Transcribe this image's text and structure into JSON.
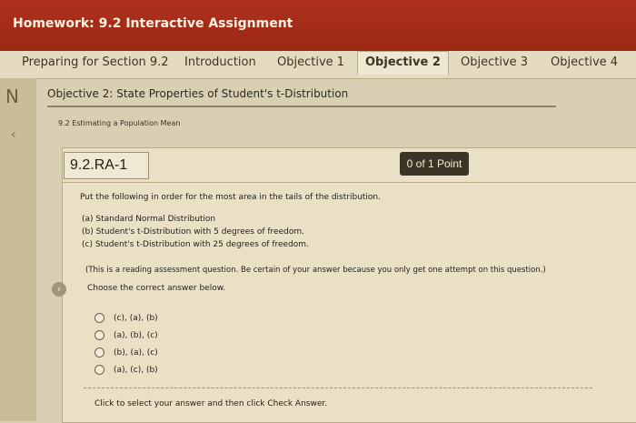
{
  "window": {
    "title": "Homework: 9.2 Interactive Assignment"
  },
  "tabs": [
    {
      "label": "Preparing for Section 9.2",
      "active": false
    },
    {
      "label": "Introduction",
      "active": false
    },
    {
      "label": "Objective 1",
      "active": false
    },
    {
      "label": "Objective 2",
      "active": true
    },
    {
      "label": "Objective 3",
      "active": false
    },
    {
      "label": "Objective 4",
      "active": false
    }
  ],
  "objective_heading": "Objective 2: State Properties of Student's t-Distribution",
  "section_label": "9.2 Estimating a Population Mean",
  "question": {
    "number": "9.2.RA-1",
    "points": "0 of 1 Point",
    "prompt": "Put the following in order for the most area in the tails of the distribution.",
    "items": [
      "(a) Standard Normal Distribution",
      "(b) Student's t-Distribution with 5 degrees of freedom.",
      "(c) Student's t-Distribution with 25 degrees of freedom."
    ],
    "note": "(This is a reading assessment question. Be certain of your answer because you only get one attempt on this question.)",
    "instruction": "Choose the correct answer below.",
    "options": [
      "(c), (a), (b)",
      "(a), (b), (c)",
      "(b), (a), (c)",
      "(a), (c), (b)"
    ],
    "footer": "Click to select your answer and then click Check Answer."
  },
  "icons": {
    "left_glyph": "N",
    "back_arrow": "‹",
    "nav_arrow": "‹"
  },
  "colors": {
    "title_bar": "#9a2815",
    "points_badge": "#3b3527"
  }
}
